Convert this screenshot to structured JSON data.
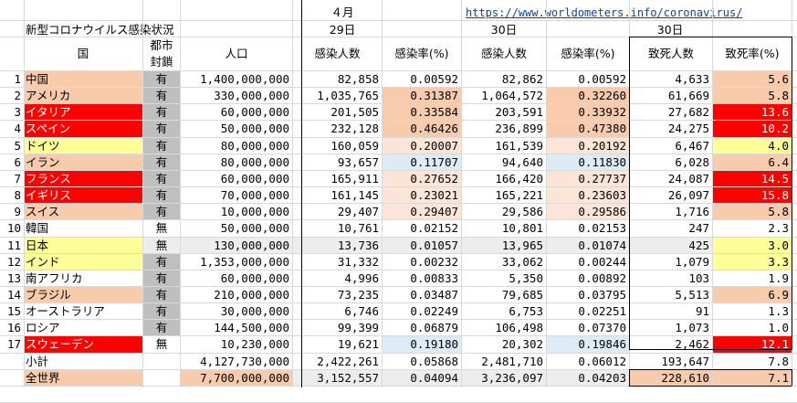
{
  "header": {
    "title": "新型コロナウイルス感染状況",
    "month": "４月",
    "url": "https://www.worldometers.info/coronavirus/",
    "date1": "29日",
    "date2": "30日",
    "date3": "30日",
    "col_country": "国",
    "col_lockdown_1": "都市",
    "col_lockdown_2": "封鎖",
    "col_population": "人口",
    "col_cases1": "感染人数",
    "col_rate1": "感染率(%)",
    "col_cases2": "感染人数",
    "col_rate2": "感染率(%)",
    "col_deaths": "致死人数",
    "col_fatality": "致死率(%)"
  },
  "colors": {
    "red": "#ff0000",
    "orange": "#f8cbad",
    "yellow": "#ffff99",
    "gray": "#bfbfbf",
    "blue": "#ddebf7",
    "peach": "#fce4d6",
    "light_gray": "#ededed"
  },
  "rows": [
    {
      "no": "1",
      "country": "中国",
      "lock": "有",
      "pop": "1,400,000,000",
      "c29": "82,858",
      "r29": "0.00592",
      "c30": "82,862",
      "r30": "0.00592",
      "deaths": "4,633",
      "fat": "5.6",
      "cc": "orange",
      "r29c": "",
      "r30c": "",
      "fc": "orange"
    },
    {
      "no": "2",
      "country": "アメリカ",
      "lock": "有",
      "pop": "330,000,000",
      "c29": "1,035,765",
      "r29": "0.31387",
      "c30": "1,064,572",
      "r30": "0.32260",
      "deaths": "61,669",
      "fat": "5.8",
      "cc": "orange",
      "r29c": "orange",
      "r30c": "orange",
      "fc": "orange"
    },
    {
      "no": "3",
      "country": "イタリア",
      "lock": "有",
      "pop": "60,000,000",
      "c29": "201,505",
      "r29": "0.33584",
      "c30": "203,591",
      "r30": "0.33932",
      "deaths": "27,682",
      "fat": "13.6",
      "cc": "red",
      "r29c": "orange",
      "r30c": "orange",
      "fc": "red"
    },
    {
      "no": "4",
      "country": "スペイン",
      "lock": "有",
      "pop": "50,000,000",
      "c29": "232,128",
      "r29": "0.46426",
      "c30": "236,899",
      "r30": "0.47380",
      "deaths": "24,275",
      "fat": "10.2",
      "cc": "red",
      "r29c": "orange",
      "r30c": "orange",
      "fc": "red"
    },
    {
      "no": "5",
      "country": "ドイツ",
      "lock": "有",
      "pop": "80,000,000",
      "c29": "160,059",
      "r29": "0.20007",
      "c30": "161,539",
      "r30": "0.20192",
      "deaths": "6,467",
      "fat": "4.0",
      "cc": "yellow",
      "r29c": "peach",
      "r30c": "peach",
      "fc": "yellow"
    },
    {
      "no": "6",
      "country": "イラン",
      "lock": "有",
      "pop": "80,000,000",
      "c29": "93,657",
      "r29": "0.11707",
      "c30": "94,640",
      "r30": "0.11830",
      "deaths": "6,028",
      "fat": "6.4",
      "cc": "orange",
      "r29c": "blue",
      "r30c": "blue",
      "fc": "orange"
    },
    {
      "no": "7",
      "country": "フランス",
      "lock": "有",
      "pop": "60,000,000",
      "c29": "165,911",
      "r29": "0.27652",
      "c30": "166,420",
      "r30": "0.27737",
      "deaths": "24,087",
      "fat": "14.5",
      "cc": "red",
      "r29c": "peach",
      "r30c": "peach",
      "fc": "red"
    },
    {
      "no": "8",
      "country": "イギリス",
      "lock": "有",
      "pop": "70,000,000",
      "c29": "161,145",
      "r29": "0.23021",
      "c30": "165,221",
      "r30": "0.23603",
      "deaths": "26,097",
      "fat": "15.8",
      "cc": "red",
      "r29c": "peach",
      "r30c": "peach",
      "fc": "red"
    },
    {
      "no": "9",
      "country": "スイス",
      "lock": "有",
      "pop": "10,000,000",
      "c29": "29,407",
      "r29": "0.29407",
      "c30": "29,586",
      "r30": "0.29586",
      "deaths": "1,716",
      "fat": "5.8",
      "cc": "orange",
      "r29c": "peach",
      "r30c": "peach",
      "fc": "orange"
    },
    {
      "no": "10",
      "country": "韓国",
      "lock": "無",
      "pop": "50,000,000",
      "c29": "10,761",
      "r29": "0.02152",
      "c30": "10,801",
      "r30": "0.02153",
      "deaths": "247",
      "fat": "2.3",
      "cc": "",
      "r29c": "",
      "r30c": "",
      "fc": ""
    },
    {
      "no": "11",
      "country": "日本",
      "lock": "無",
      "pop": "130,000,000",
      "c29": "13,736",
      "r29": "0.01057",
      "c30": "13,965",
      "r30": "0.01074",
      "deaths": "425",
      "fat": "3.0",
      "cc": "yellow",
      "r29c": "",
      "r30c": "",
      "fc": "yellow",
      "rowbg": "light_gray"
    },
    {
      "no": "12",
      "country": "インド",
      "lock": "有",
      "pop": "1,353,000,000",
      "c29": "31,332",
      "r29": "0.00232",
      "c30": "33,062",
      "r30": "0.00244",
      "deaths": "1,079",
      "fat": "3.3",
      "cc": "yellow",
      "r29c": "",
      "r30c": "",
      "fc": "yellow"
    },
    {
      "no": "13",
      "country": "南アフリカ",
      "lock": "有",
      "pop": "60,000,000",
      "c29": "4,996",
      "r29": "0.00833",
      "c30": "5,350",
      "r30": "0.00892",
      "deaths": "103",
      "fat": "1.9",
      "cc": "",
      "r29c": "",
      "r30c": "",
      "fc": ""
    },
    {
      "no": "14",
      "country": "ブラジル",
      "lock": "有",
      "pop": "210,000,000",
      "c29": "73,235",
      "r29": "0.03487",
      "c30": "79,685",
      "r30": "0.03795",
      "deaths": "5,513",
      "fat": "6.9",
      "cc": "orange",
      "r29c": "",
      "r30c": "",
      "fc": "orange"
    },
    {
      "no": "15",
      "country": "オーストラリア",
      "lock": "有",
      "pop": "30,000,000",
      "c29": "6,746",
      "r29": "0.02249",
      "c30": "6,753",
      "r30": "0.02251",
      "deaths": "91",
      "fat": "1.3",
      "cc": "",
      "r29c": "",
      "r30c": "",
      "fc": ""
    },
    {
      "no": "16",
      "country": "ロシア",
      "lock": "有",
      "pop": "144,500,000",
      "c29": "99,399",
      "r29": "0.06879",
      "c30": "106,498",
      "r30": "0.07370",
      "deaths": "1,073",
      "fat": "1.0",
      "cc": "",
      "r29c": "",
      "r30c": "",
      "fc": ""
    },
    {
      "no": "17",
      "country": "スウェーデン",
      "lock": "無",
      "pop": "10,230,000",
      "c29": "19,621",
      "r29": "0.19180",
      "c30": "20,302",
      "r30": "0.19846",
      "deaths": "2,462",
      "fat": "12.1",
      "cc": "red",
      "r29c": "blue",
      "r30c": "blue",
      "fc": "red"
    }
  ],
  "subtotal": {
    "label": "小計",
    "pop": "4,127,730,000",
    "c29": "2,422,261",
    "r29": "0.05868",
    "c30": "2,481,710",
    "r30": "0.06012",
    "deaths": "193,647",
    "fat": "7.8"
  },
  "world": {
    "label": "全世界",
    "pop": "7,700,000,000",
    "c29": "3,152,557",
    "r29": "0.04094",
    "c30": "3,236,097",
    "r30": "0.04203",
    "deaths": "228,610",
    "fat": "7.1"
  }
}
